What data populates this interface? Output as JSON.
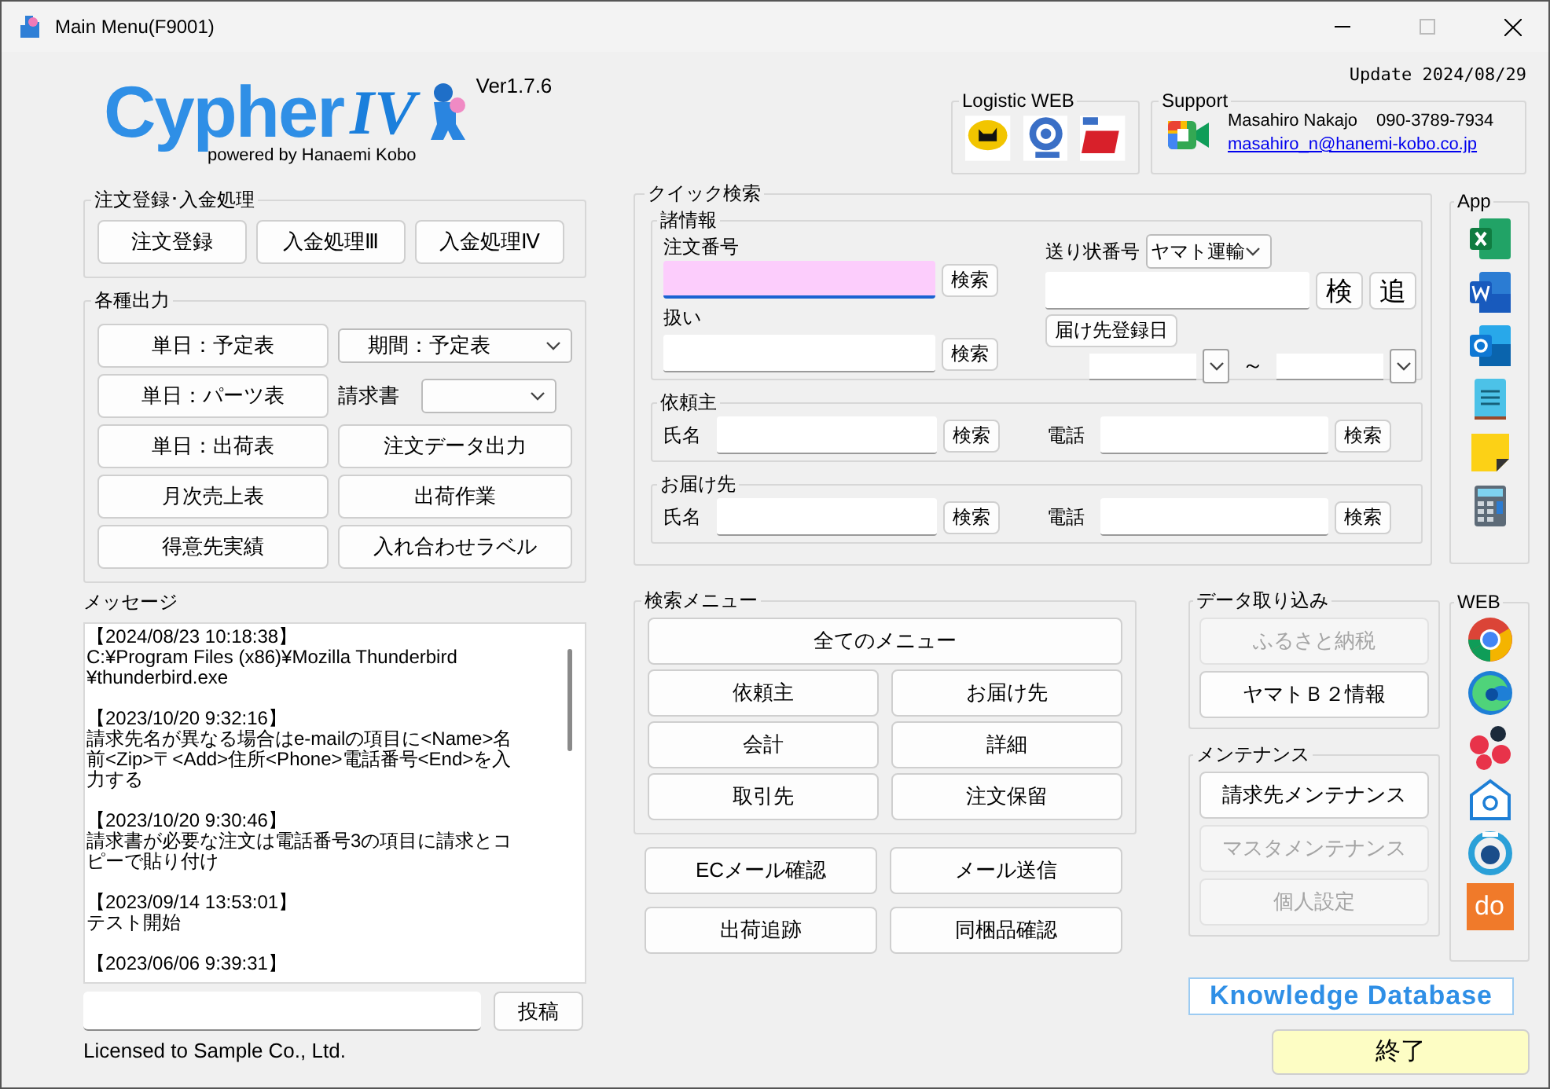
{
  "window": {
    "title": "Main Menu(F9001)"
  },
  "header": {
    "logo_text": "Cypher",
    "logo_numeral": "IV",
    "tagline": "powered by Hanaemi Kobo",
    "version": "Ver1.7.6",
    "update": "Update 2024/08/29"
  },
  "logistic_web": {
    "title": "Logistic WEB"
  },
  "support": {
    "title": "Support",
    "name": "Masahiro Nakajo",
    "phone": "090-3789-7934",
    "email": "masahiro_n@hanemi-kobo.co.jp"
  },
  "order_group": {
    "title": "注文登録･入金処理",
    "buttons": [
      "注文登録",
      "入金処理Ⅲ",
      "入金処理Ⅳ"
    ]
  },
  "output_group": {
    "title": "各種出力",
    "items": [
      {
        "kind": "button",
        "label": "単日：予定表"
      },
      {
        "kind": "dropdown",
        "value": "期間：予定表"
      },
      {
        "kind": "button",
        "label": "単日：パーツ表"
      },
      {
        "kind": "labeled_dropdown",
        "label": "請求書"
      },
      {
        "kind": "button",
        "label": "単日：出荷表"
      },
      {
        "kind": "button",
        "label": "注文データ出力"
      },
      {
        "kind": "button",
        "label": "月次売上表"
      },
      {
        "kind": "button",
        "label": "出荷作業"
      },
      {
        "kind": "button",
        "label": "得意先実績"
      },
      {
        "kind": "button",
        "label": "入れ合わせラベル"
      }
    ]
  },
  "messages": {
    "title": "メッセージ",
    "entries": [
      {
        "time": "【2024/08/23 10:18:38】",
        "text": "C:¥Program Files (x86)¥Mozilla Thunderbird ¥thunderbird.exe"
      },
      {
        "time": "【2023/10/20 9:32:16】",
        "text": "請求先名が異なる場合はe-mailの項目に<Name>名前<Zip>〒<Add>住所<Phone>電話番号<End>を入力する"
      },
      {
        "time": "【2023/10/20 9:30:46】",
        "text": "請求書が必要な注文は電話番号3の項目に請求とコピーで貼り付け"
      },
      {
        "time": "【2023/09/14 13:53:01】",
        "text": "テスト開始"
      },
      {
        "time": "【2023/06/06 9:39:31】"
      }
    ]
  },
  "post": {
    "button": "投稿"
  },
  "license": "Licensed to Sample Co., Ltd.",
  "quick_search": {
    "title": "クイック検索",
    "info": {
      "title": "諸情報",
      "order_number": {
        "label": "注文番号",
        "focused": true,
        "button": "検索"
      },
      "handling": {
        "label": "扱い",
        "button": "検索"
      },
      "tracking": {
        "label": "送り状番号",
        "carrier": "ヤマト運輸",
        "buttons": [
          "検",
          "追"
        ]
      },
      "delivery_date": {
        "button": "届け先登録日",
        "separator": "～"
      }
    },
    "client": {
      "title": "依頼主",
      "name_label": "氏名",
      "name_button": "検索",
      "phone_label": "電話",
      "phone_button": "検索"
    },
    "recipient": {
      "title": "お届け先",
      "name_label": "氏名",
      "name_button": "検索",
      "phone_label": "電話",
      "phone_button": "検索"
    }
  },
  "app": {
    "title": "App"
  },
  "search_menu": {
    "title": "検索メニュー",
    "buttons": [
      {
        "label": "全てのメニュー",
        "wide": true
      },
      {
        "label": "依頼主",
        "wide": false
      },
      {
        "label": "お届け先",
        "wide": false
      },
      {
        "label": "会計",
        "wide": false
      },
      {
        "label": "詳細",
        "wide": false
      },
      {
        "label": "取引先",
        "wide": false
      },
      {
        "label": "注文保留",
        "wide": false
      }
    ]
  },
  "extra_buttons": [
    "ECメール確認",
    "メール送信",
    "出荷追跡",
    "同梱品確認"
  ],
  "data_import": {
    "title": "データ取り込み",
    "buttons": [
      {
        "label": "ふるさと納税",
        "disabled": true
      },
      {
        "label": "ヤマトＢ２情報",
        "disabled": false
      }
    ]
  },
  "maintenance": {
    "title": "メンテナンス",
    "buttons": [
      {
        "label": "請求先メンテナンス",
        "disabled": false
      },
      {
        "label": "マスタメンテナンス",
        "disabled": true
      },
      {
        "label": "個人設定",
        "disabled": true
      }
    ]
  },
  "web": {
    "title": "WEB",
    "tile_text": "do"
  },
  "knowledge": "Knowledge Database",
  "exit_button": "終了"
}
